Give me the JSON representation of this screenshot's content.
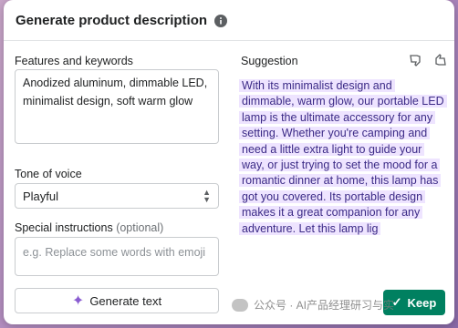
{
  "dialog": {
    "title": "Generate product description"
  },
  "features": {
    "label": "Features and keywords",
    "value": "Anodized aluminum, dimmable LED,\nminimalist design, soft warm glow"
  },
  "tone": {
    "label": "Tone of voice",
    "value": "Playful"
  },
  "special": {
    "label": "Special instructions",
    "optional": "(optional)",
    "placeholder": "e.g. Replace some words with emoji"
  },
  "generate": {
    "label": "Generate text"
  },
  "suggestion": {
    "label": "Suggestion",
    "text": "With its minimalist design and dimmable, warm glow, our portable LED lamp is the ultimate accessory for any setting. Whether you're camping and need a little extra light to guide your way, or just trying to set the mood for a romantic dinner at home, this lamp has got you covered. Its portable design makes it a great companion for any adventure. Let this lamp lig"
  },
  "keep": {
    "label": "Keep"
  },
  "watermark": {
    "text": "公众号 · AI产品经理研习与实"
  },
  "colors": {
    "accent_green": "#008060",
    "suggestion_highlight": "#eee4ff",
    "suggestion_text": "#3b2a86",
    "sparkle": "#8a5cd1"
  },
  "icons": {
    "info": "info-icon",
    "thumbs_down": "thumbs-down-icon",
    "thumbs_up": "thumbs-up-icon",
    "sparkle": "sparkle-icon",
    "check": "check-icon",
    "chevron": "chevron-updown-icon"
  }
}
